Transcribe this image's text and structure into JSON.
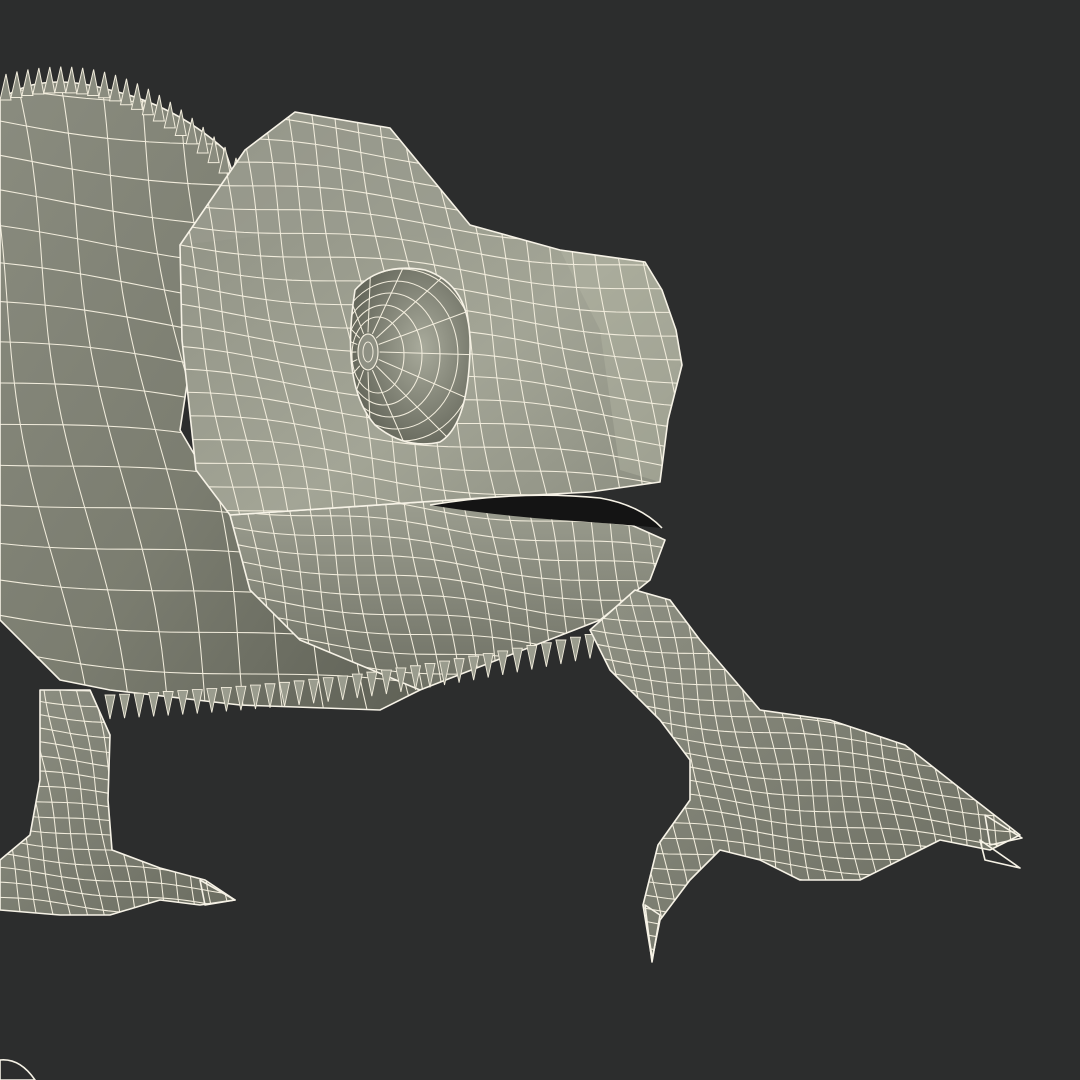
{
  "scene": {
    "subject": "",
    "colors": {
      "background": "#2c2d2d",
      "mesh_fill": "#858779",
      "mesh_fill_light": "#a6a898",
      "mesh_shadow": "#4c4e45",
      "wireframe": "#f1ecdc",
      "mouth": "#141414"
    }
  }
}
